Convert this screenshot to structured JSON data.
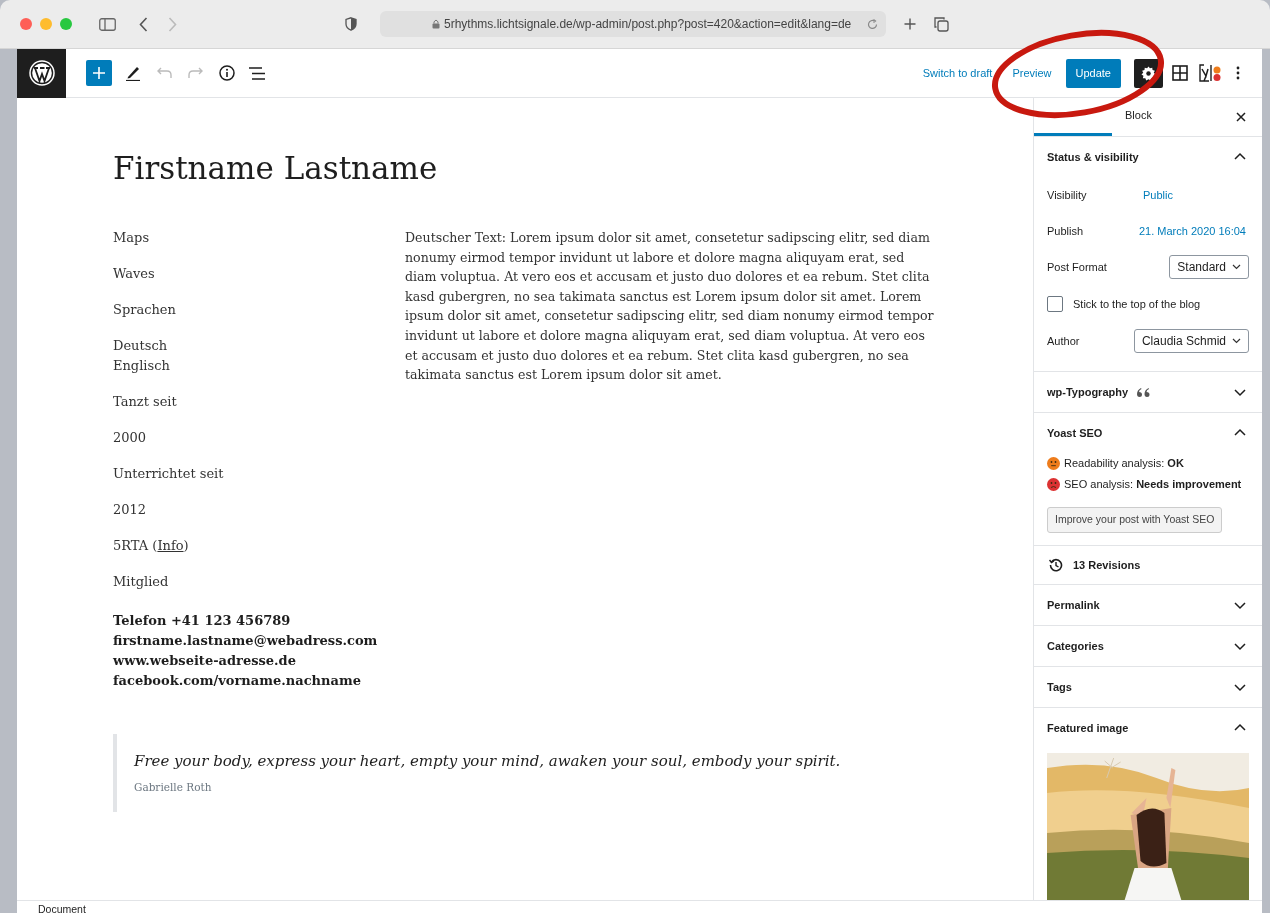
{
  "browser": {
    "url": "5rhythms.lichtsignale.de/wp-admin/post.php?post=420&action=edit&lang=de"
  },
  "toolbar": {
    "switch_to_draft": "Switch to draft",
    "preview": "Preview",
    "update": "Update"
  },
  "editor": {
    "title": "Firstname Lastname",
    "left_column": [
      {
        "kind": "text",
        "lines": [
          "Maps"
        ]
      },
      {
        "kind": "text",
        "lines": [
          "Waves"
        ]
      },
      {
        "kind": "text",
        "lines": [
          "Sprachen"
        ]
      },
      {
        "kind": "text",
        "lines": [
          "Deutsch",
          "Englisch"
        ]
      },
      {
        "kind": "text",
        "lines": [
          "Tanzt seit"
        ]
      },
      {
        "kind": "text",
        "lines": [
          "2000"
        ]
      },
      {
        "kind": "text",
        "lines": [
          "Unterrichtet seit"
        ]
      },
      {
        "kind": "text",
        "lines": [
          " 2012"
        ]
      },
      {
        "kind": "link",
        "before": "5RTA (",
        "link": "Info",
        "after": ")"
      },
      {
        "kind": "text",
        "lines": [
          "Mitglied"
        ]
      },
      {
        "kind": "bold",
        "lines": [
          "Telefon +41 123 456789",
          "firstname.lastname@webadress.com",
          "www.webseite-adresse.de",
          "facebook.com/vorname.nachname"
        ]
      }
    ],
    "body": "Deutscher Text: Lorem ipsum dolor sit amet, consetetur sadipscing elitr, sed diam nonumy eirmod tempor invidunt ut labore et dolore magna aliquyam erat, sed diam voluptua. At vero eos et accusam et justo duo dolores et ea rebum. Stet clita kasd gubergren, no sea takimata sanctus est Lorem ipsum dolor sit amet. Lorem ipsum dolor sit amet, consetetur sadipscing elitr, sed diam nonumy eirmod tempor invidunt ut labore et dolore magna aliquyam erat, sed diam voluptua. At vero eos et accusam et justo duo dolores et ea rebum. Stet clita kasd gubergren, no sea takimata sanctus est Lorem ipsum dolor sit amet.",
    "quote": {
      "text": "Free your body, express your heart, empty your mind, awaken your soul, embody your spirit.",
      "citation": "Gabrielle Roth"
    }
  },
  "sidebar": {
    "tabs": [
      {
        "selected": true
      },
      {
        "label": "Block",
        "selected": false
      }
    ],
    "panels": [
      {
        "kind": "status",
        "title": "Status & visibility",
        "expanded": true,
        "visibility": {
          "label": "Visibility",
          "value": "Public"
        },
        "publish": {
          "label": "Publish",
          "value": "21. March 2020 16:04"
        },
        "post_format": {
          "label": "Post Format",
          "value": "Standard"
        },
        "sticky": {
          "label": "Stick to the top of the blog",
          "checked": false
        },
        "author": {
          "label": "Author",
          "value": "Claudia Schmid"
        }
      },
      {
        "kind": "plain",
        "title": "wp-Typography",
        "expanded": false,
        "quote_icon": true
      },
      {
        "kind": "yoast",
        "title": "Yoast SEO",
        "expanded": true,
        "analyses": [
          {
            "label": "Readability analysis: ",
            "result": "OK",
            "color": "#ee7c1b"
          },
          {
            "label": "SEO analysis: ",
            "result": "Needs improvement",
            "color": "#dc3232"
          }
        ],
        "button": "Improve your post with Yoast SEO"
      },
      {
        "kind": "revisions",
        "title": "13 Revisions"
      },
      {
        "kind": "plain",
        "title": "Permalink",
        "expanded": false
      },
      {
        "kind": "plain",
        "title": "Categories",
        "expanded": false
      },
      {
        "kind": "plain",
        "title": "Tags",
        "expanded": false
      },
      {
        "kind": "featured",
        "title": "Featured image",
        "expanded": true
      }
    ]
  },
  "footer": {
    "breadcrumb": "Document"
  }
}
